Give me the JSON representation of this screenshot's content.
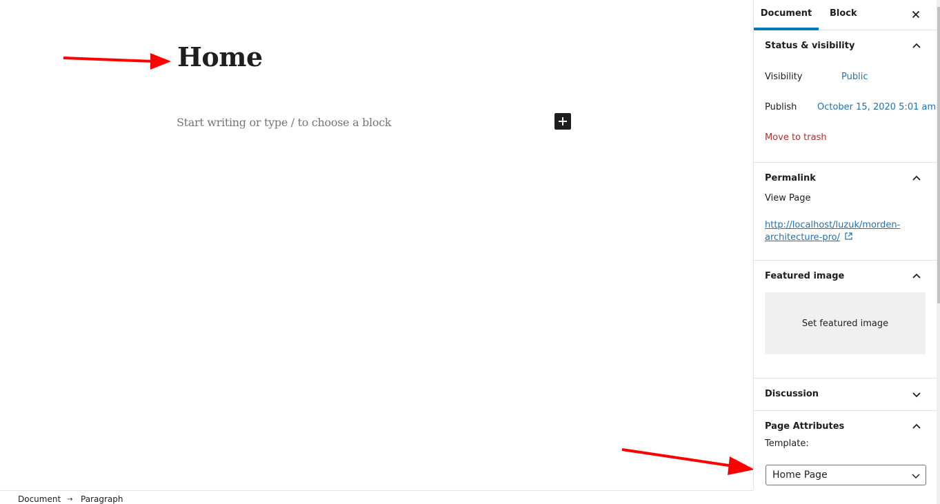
{
  "editor": {
    "title": "Home",
    "placeholder": "Start writing or type / to choose a block",
    "inserter_icon": "plus-icon"
  },
  "footer": {
    "breadcrumb": [
      "Document",
      "Paragraph"
    ],
    "separator": "→"
  },
  "sidebar": {
    "tabs": [
      {
        "label": "Document",
        "active": true
      },
      {
        "label": "Block",
        "active": false
      }
    ],
    "close_icon": "close-icon",
    "status": {
      "title": "Status & visibility",
      "expanded": true,
      "visibility_label": "Visibility",
      "visibility_value": "Public",
      "publish_label": "Publish",
      "publish_value": "October 15, 2020 5:01 am",
      "trash_label": "Move to trash"
    },
    "permalink": {
      "title": "Permalink",
      "expanded": true,
      "view_label": "View Page",
      "url_line1": "http://localhost/luzuk/morden-",
      "url_line2": "architecture-pro/"
    },
    "featured": {
      "title": "Featured image",
      "expanded": true,
      "button_label": "Set featured image"
    },
    "discussion": {
      "title": "Discussion",
      "expanded": false
    },
    "page_attributes": {
      "title": "Page Attributes",
      "expanded": true,
      "template_label": "Template:",
      "template_value": "Home Page"
    }
  },
  "colors": {
    "accent": "#007cba",
    "link": "#2271b1",
    "danger": "#b32d2e",
    "annotation_arrow": "#ff0000"
  }
}
